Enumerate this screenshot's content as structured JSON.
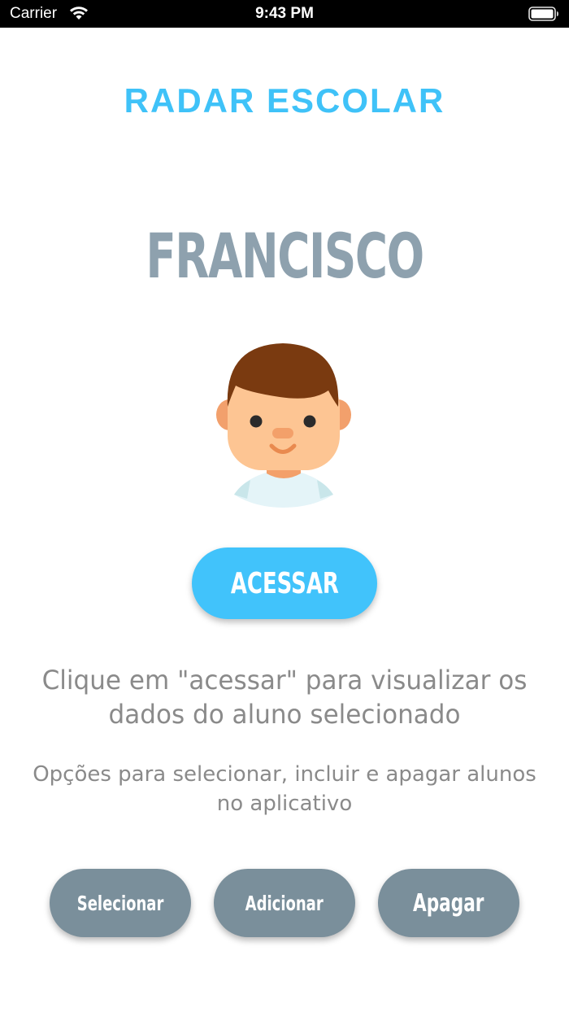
{
  "status_bar": {
    "carrier": "Carrier",
    "time": "9:43 PM"
  },
  "header": {
    "title": "RADAR ESCOLAR"
  },
  "student": {
    "name": "FRANCISCO",
    "avatar_icon": "boy-avatar-icon"
  },
  "access": {
    "label": "ACESSAR"
  },
  "hints": {
    "main": "Clique em \"acessar\" para visualizar os dados do aluno selecionado",
    "secondary": "Opções para selecionar, incluir e apagar alunos no aplicativo"
  },
  "actions": {
    "select_label": "Selecionar",
    "add_label": "Adicionar",
    "delete_label": "Apagar"
  },
  "colors": {
    "accent": "#41c3fb",
    "title": "#3fc2f8",
    "name": "#8ea1ae",
    "secondary_button": "#7a8f9b",
    "hint_text": "#8a8a8a"
  }
}
